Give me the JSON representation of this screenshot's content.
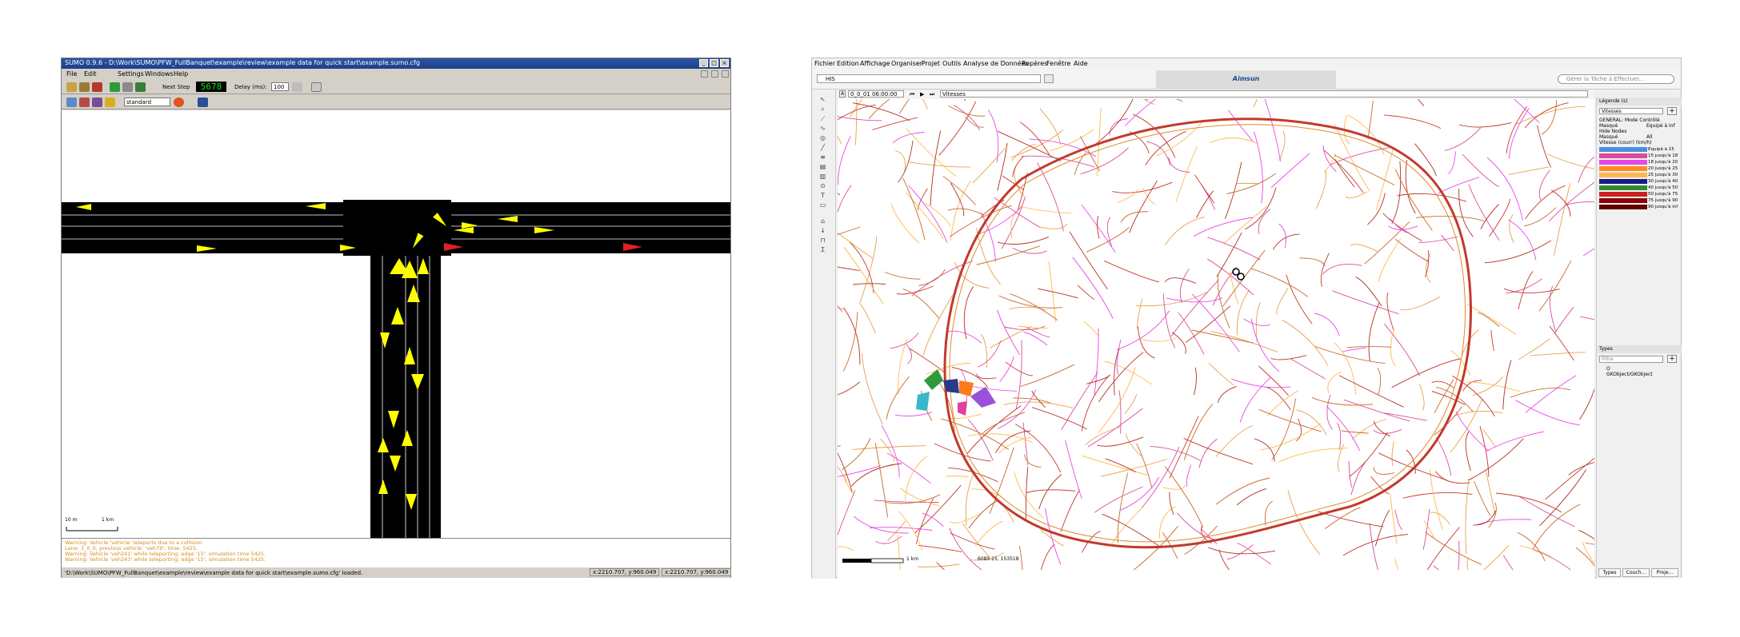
{
  "sumo": {
    "title": "SUMO 0.9.6 - D:\\Work\\SUMO\\PFW_FullBanquet\\example\\review\\example data for quick start\\example.sumo.cfg",
    "menu": [
      "File",
      "Edit",
      "Settings",
      "Windows",
      "Help"
    ],
    "next_step_label": "Next Step",
    "step_value": "5678",
    "delay_label": "Delay (ms):",
    "delay_value": "100",
    "scheme_value": "standard",
    "scale_labels": [
      "10 m",
      "1 km"
    ],
    "messages": [
      "Warning: Vehicle 'vehicle' teleports due to a collision",
      "  Lane: 1_0_0; previous vehicle: 'veh79'; time: 5425.",
      "Warning: Vehicle 'veh241' while teleporting; edge '15'; simulation time 5425.",
      "Warning: Vehicle 'veh243' while teleporting; edge '15'; simulation time 5425."
    ],
    "status_text": "'D:\\Work\\SUMO\\PFW_FullBanquet\\example\\review\\example data for quick start\\example.sumo.cfg' loaded.",
    "coords": [
      "x:2210.707, y:960.049",
      "x:2210.707, y:960.049"
    ],
    "colors": {
      "road": "#000000",
      "vehicle": "#ffff00",
      "signal_red": "#e02020",
      "lcd": "#19e219"
    }
  },
  "paris": {
    "menu": [
      "Fichier",
      "Edition",
      "Affichage",
      "Organiser",
      "Projet",
      "Outils",
      "Analyse de Données",
      "Repères",
      "Fenêtre",
      "Aide"
    ],
    "project_combo": "HIS",
    "brand": "Aimsun",
    "search_placeholder": "Gérer la Tâche à Effectuer...",
    "time_value": "0_0_01 06:00:00",
    "view_mode": "Vitesses",
    "scale_label": "1 km",
    "coords_text": "6085 15, 153518",
    "legend": {
      "title": "Légende (s)",
      "dropdown": "Vitesses",
      "lines": [
        "GENERAL: Mode Contrôlé",
        "Masqué",
        "Hide Nodes",
        "Masqué",
        "Vitesse (courr) (km/h)"
      ],
      "right_lines": [
        "Equipé à inf",
        "",
        "",
        "All",
        ""
      ],
      "classes": [
        {
          "label": "Equipé à 15",
          "color": "#4a90e2"
        },
        {
          "label": "15 jusqu'à 18",
          "color": "#d94d9a"
        },
        {
          "label": "18 jusqu'à 20",
          "color": "#e846e8"
        },
        {
          "label": "20 jusqu'à 25",
          "color": "#ff8c1a"
        },
        {
          "label": "25 jusqu'à 30",
          "color": "#ffb84d"
        },
        {
          "label": "30 jusqu'à 40",
          "color": "#1a1a8a"
        },
        {
          "label": "40 jusqu'à 50",
          "color": "#2e8b2e"
        },
        {
          "label": "50 jusqu'à 75",
          "color": "#cc2020"
        },
        {
          "label": "75 jusqu'à 90",
          "color": "#8b0000"
        },
        {
          "label": "90 jusqu'à inf",
          "color": "#600000"
        }
      ]
    },
    "types": {
      "title": "Types",
      "filter": "Filtre",
      "items": [
        "O",
        "GKObject/GKObject"
      ]
    },
    "tabs": [
      "Types",
      "Couch...",
      "Proje..."
    ]
  }
}
